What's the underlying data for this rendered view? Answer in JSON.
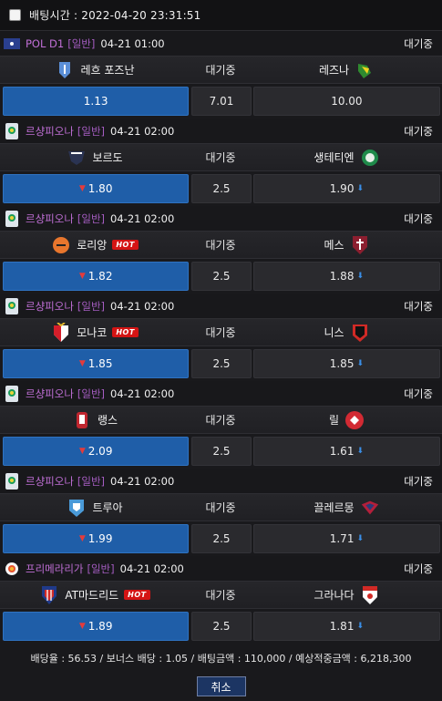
{
  "header": {
    "betting_time_label": "배팅시간 : 2022-04-20 23:31:51"
  },
  "matches": [
    {
      "league": "POL D1",
      "tag": "[일반]",
      "time": "04-21 01:00",
      "status": "대기중",
      "home": "레흐 포즈난",
      "mid": "대기중",
      "away": "레즈나",
      "home_odd": "1.13",
      "draw_odd": "7.01",
      "away_odd": "10.00",
      "home_hot": false,
      "away_hot": false,
      "home_arrow": "",
      "away_arrow": "",
      "league_icon": "poland-flag-icon",
      "home_icon": "lech-crest-icon",
      "away_icon": "legnica-crest-icon"
    },
    {
      "league": "르샹피오나",
      "tag": "[일반]",
      "time": "04-21 02:00",
      "status": "대기중",
      "home": "보르도",
      "mid": "대기중",
      "away": "생테티엔",
      "home_odd": "1.80",
      "draw_odd": "2.5",
      "away_odd": "1.90",
      "home_hot": false,
      "away_hot": false,
      "home_arrow": "▼",
      "away_arrow": "⬇",
      "league_icon": "ligue1-icon",
      "home_icon": "bordeaux-crest-icon",
      "away_icon": "saint-etienne-crest-icon"
    },
    {
      "league": "르샹피오나",
      "tag": "[일반]",
      "time": "04-21 02:00",
      "status": "대기중",
      "home": "로리앙",
      "mid": "대기중",
      "away": "메스",
      "home_odd": "1.82",
      "draw_odd": "2.5",
      "away_odd": "1.88",
      "home_hot": true,
      "away_hot": false,
      "home_arrow": "▼",
      "away_arrow": "⬇",
      "league_icon": "ligue1-icon",
      "home_icon": "lorient-crest-icon",
      "away_icon": "metz-crest-icon"
    },
    {
      "league": "르샹피오나",
      "tag": "[일반]",
      "time": "04-21 02:00",
      "status": "대기중",
      "home": "모나코",
      "mid": "대기중",
      "away": "니스",
      "home_odd": "1.85",
      "draw_odd": "2.5",
      "away_odd": "1.85",
      "home_hot": true,
      "away_hot": false,
      "home_arrow": "▼",
      "away_arrow": "⬇",
      "league_icon": "ligue1-icon",
      "home_icon": "monaco-crest-icon",
      "away_icon": "nice-crest-icon"
    },
    {
      "league": "르샹피오나",
      "tag": "[일반]",
      "time": "04-21 02:00",
      "status": "대기중",
      "home": "랭스",
      "mid": "대기중",
      "away": "릴",
      "home_odd": "2.09",
      "draw_odd": "2.5",
      "away_odd": "1.61",
      "home_hot": false,
      "away_hot": false,
      "home_arrow": "▼",
      "away_arrow": "⬇",
      "league_icon": "ligue1-icon",
      "home_icon": "reims-crest-icon",
      "away_icon": "lille-crest-icon"
    },
    {
      "league": "르샹피오나",
      "tag": "[일반]",
      "time": "04-21 02:00",
      "status": "대기중",
      "home": "트루아",
      "mid": "대기중",
      "away": "끌레르몽",
      "home_odd": "1.99",
      "draw_odd": "2.5",
      "away_odd": "1.71",
      "home_hot": false,
      "away_hot": false,
      "home_arrow": "▼",
      "away_arrow": "⬇",
      "league_icon": "ligue1-icon",
      "home_icon": "troyes-crest-icon",
      "away_icon": "clermont-crest-icon"
    },
    {
      "league": "프리메라리가",
      "tag": "[일반]",
      "time": "04-21 02:00",
      "status": "대기중",
      "home": "AT마드리드",
      "mid": "대기중",
      "away": "그라나다",
      "home_odd": "1.89",
      "draw_odd": "2.5",
      "away_odd": "1.81",
      "home_hot": true,
      "away_hot": false,
      "home_arrow": "▼",
      "away_arrow": "⬇",
      "league_icon": "laliga-icon",
      "home_icon": "atletico-crest-icon",
      "away_icon": "granada-crest-icon"
    }
  ],
  "hot_label": "HOT",
  "summary": "배당율 : 56.53 / 보너스 배당 : 1.05 / 배팅금액 : 110,000 / 예상적중금액 : 6,218,300",
  "cancel_label": "취소",
  "colors": {
    "selected": "#1f5ea8",
    "league_name": "#c06fd6",
    "up_arrow": "#e43b3b",
    "down_arrow": "#3a8fe8",
    "hot": "#d41414"
  }
}
